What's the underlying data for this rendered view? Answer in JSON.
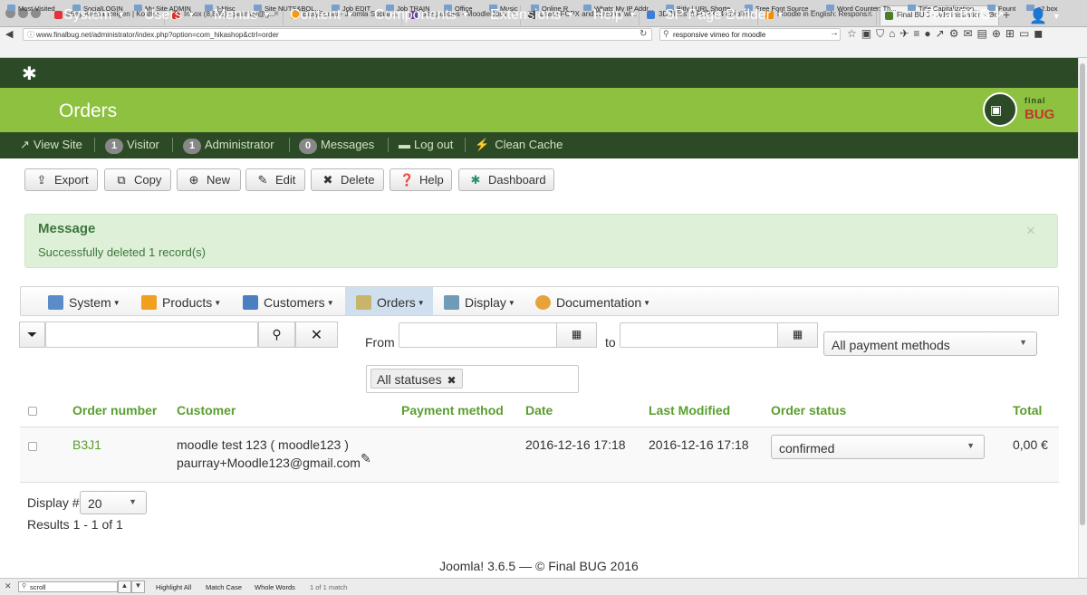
{
  "browser": {
    "tabs": [
      {
        "label": "eBay Kleinanzeigen | Koste...",
        "color": "#e53238"
      },
      {
        "label": "Inbox (8,885) - paurray@g...",
        "color": "#d93025"
      },
      {
        "label": "EasySocial - Joomla Social ...",
        "color": "#f39c12"
      },
      {
        "label": "Site policies - MoodleDocs",
        "color": "#6b3fa0"
      },
      {
        "label": "Learn FCPX and Resolve wi...",
        "color": "#444444"
      },
      {
        "label": "3D Titles in FCPX: 4 enrolle...",
        "color": "#3b7dd8"
      },
      {
        "label": "Moodle in English: Respons...",
        "color": "#f28c00"
      },
      {
        "label": "Final BUG - Administration - Or...",
        "color": "#4a7d2a"
      }
    ],
    "new_tab": "+",
    "url": "www.finalbug.net/administrator/index.php?option=com_hikashop&ctrl=order",
    "search": "responsive vimeo for moodle",
    "bookmarks": [
      "Most Visited",
      "SocialLOGIN",
      "My Site ADMIN",
      "J-Misc",
      "Site NUTS&BOL...",
      "Job EDIT",
      "Job TRAIN",
      "Office",
      "Music",
      "Online R",
      "Whats My IP Addr...",
      "Bitly | URL Shorte...",
      "Free Font Source ...",
      "Word Counter: Th...",
      "Title Capitalization...",
      "Fount",
      "o2.box"
    ]
  },
  "topmenu": {
    "items": [
      "System",
      "Users",
      "Menus",
      "Content",
      "Components",
      "Extensions",
      "Help",
      "SP Page Builder"
    ],
    "site_link": "Final BUG",
    "user_icon": "user-icon"
  },
  "header": {
    "title": "Orders",
    "logo_text_top": "final",
    "logo_text_bottom": "BUG"
  },
  "status": {
    "view_site": "View Site",
    "visitor_count": "1",
    "visitor_label": "Visitor",
    "admin_count": "1",
    "admin_label": "Administrator",
    "messages_count": "0",
    "messages_label": "Messages",
    "logout": "Log out",
    "clean_cache": "Clean Cache"
  },
  "toolbar": {
    "export": "Export",
    "copy": "Copy",
    "new": "New",
    "edit": "Edit",
    "delete": "Delete",
    "help": "Help",
    "dashboard": "Dashboard"
  },
  "message": {
    "title": "Message",
    "body": "Successfully deleted 1 record(s)",
    "close": "×"
  },
  "hikamenu": {
    "items": [
      "System",
      "Products",
      "Customers",
      "Orders",
      "Display",
      "Documentation"
    ],
    "active": "Orders"
  },
  "filters": {
    "from_label": "From",
    "to_label": "to",
    "payment": "All payment methods",
    "status_tag": "All statuses"
  },
  "table": {
    "headers": [
      "Order number",
      "Customer",
      "Payment method",
      "Date",
      "Last Modified",
      "Order status",
      "Total"
    ],
    "rows": [
      {
        "order_number": "B3J1",
        "customer_name": "moodle test 123 ( moodle123 )",
        "customer_email": "paurray+Moodle123@gmail.com",
        "payment_method": "",
        "date": "2016-12-16 17:18",
        "last_modified": "2016-12-16 17:18",
        "status": "confirmed",
        "total": "0,00 €"
      }
    ]
  },
  "pagination": {
    "display_label": "Display #",
    "display_value": "20",
    "results": "Results 1 - 1 of 1"
  },
  "footer": "Joomla! 3.6.5  —  © Final BUG 2016",
  "findbar": {
    "query": "scroll",
    "highlight_all": "Highlight All",
    "match_case": "Match Case",
    "whole_words": "Whole Words",
    "result": "1 of 1 match"
  },
  "colors": {
    "menu_dark": "#2d4a27",
    "brand_green": "#8dc13f",
    "link_green": "#5a9e2d",
    "message_bg": "#dff0d8"
  }
}
